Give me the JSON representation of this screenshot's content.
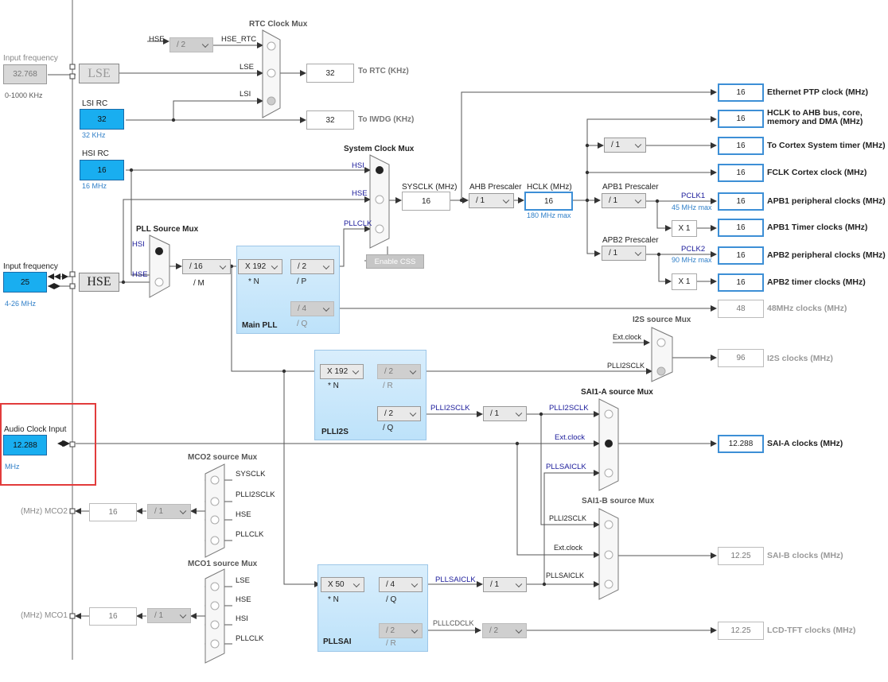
{
  "inputs": {
    "lse_input": {
      "title": "Input frequency",
      "value": "32.768",
      "range": "0-1000 KHz",
      "osc_label": "LSE"
    },
    "lsi_rc": {
      "title": "LSI RC",
      "value": "32",
      "unit": "32 KHz"
    },
    "hsi_rc": {
      "title": "HSI RC",
      "value": "16",
      "unit": "16 MHz"
    },
    "hse_input": {
      "title": "Input frequency",
      "value": "25",
      "range": "4-26 MHz",
      "osc_label": "HSE"
    },
    "audio_clock": {
      "title": "Audio Clock Input",
      "value": "12.288",
      "unit": "MHz"
    }
  },
  "rtc_mux": {
    "title": "RTC Clock Mux",
    "hse_label": "HSE",
    "hse_div": "/ 2",
    "inputs": [
      "HSE_RTC",
      "LSE",
      "LSI"
    ]
  },
  "to_rtc": {
    "value": "32",
    "label": "To RTC (KHz)"
  },
  "to_iwdg": {
    "value": "32",
    "label": "To IWDG (KHz)"
  },
  "system_mux": {
    "title": "System Clock Mux",
    "inputs": [
      "HSI",
      "HSE",
      "PLLCLK"
    ],
    "enable_css": "Enable CSS"
  },
  "sysclk": {
    "label": "SYSCLK (MHz)",
    "value": "16"
  },
  "ahb_prescaler": {
    "label": "AHB Prescaler",
    "value": "/ 1"
  },
  "hclk": {
    "label": "HCLK (MHz)",
    "value": "16",
    "max": "180 MHz max"
  },
  "apb1_prescaler": {
    "label": "APB1 Prescaler",
    "value": "/ 1",
    "pclk": "PCLK1",
    "max": "45 MHz max",
    "x": "X 1"
  },
  "apb2_prescaler": {
    "label": "APB2 Prescaler",
    "value": "/ 1",
    "pclk": "PCLK2",
    "max": "90 MHz max",
    "x": "X 1"
  },
  "cortex_div": "/ 1",
  "outputs": [
    {
      "value": "16",
      "label": "Ethernet PTP clock (MHz)"
    },
    {
      "value": "16",
      "label": "HCLK to AHB bus, core,",
      "label2": "memory and DMA (MHz)"
    },
    {
      "value": "16",
      "label": "To Cortex System timer (MHz)"
    },
    {
      "value": "16",
      "label": "FCLK Cortex clock (MHz)"
    },
    {
      "value": "16",
      "label": "APB1 peripheral clocks (MHz)"
    },
    {
      "value": "16",
      "label": "APB1 Timer clocks (MHz)"
    },
    {
      "value": "16",
      "label": "APB2 peripheral clocks (MHz)"
    },
    {
      "value": "16",
      "label": "APB2 timer clocks (MHz)"
    },
    {
      "value": "48",
      "label": "48MHz clocks (MHz)"
    },
    {
      "value": "96",
      "label": "I2S clocks (MHz)"
    },
    {
      "value": "12.288",
      "label": "SAI-A clocks (MHz)"
    },
    {
      "value": "12.25",
      "label": "SAI-B clocks (MHz)"
    },
    {
      "value": "12.25",
      "label": "LCD-TFT clocks (MHz)"
    }
  ],
  "pll_source_mux": {
    "title": "PLL Source Mux",
    "inputs": [
      "HSI",
      "HSE"
    ],
    "m_div": "/ 16",
    "m_label": "/ M"
  },
  "main_pll": {
    "title": "Main PLL",
    "n": "X 192",
    "n_label": "* N",
    "p": "/ 2",
    "p_label": "/ P",
    "q": "/ 4",
    "q_label": "/ Q"
  },
  "plli2s": {
    "title": "PLLI2S",
    "n": "X 192",
    "n_label": "* N",
    "r": "/ 2",
    "r_label": "/ R",
    "q": "/ 2",
    "q_label": "/ Q",
    "signal": "PLLI2SCLK",
    "div": "/ 1"
  },
  "pllsai": {
    "title": "PLLSAI",
    "n": "X 50",
    "n_label": "* N",
    "q": "/ 4",
    "q_label": "/ Q",
    "r": "/ 2",
    "r_label": "/ R",
    "signal": "PLLSAICLK",
    "div": "/ 1",
    "lcd_signal": "PLLLCDCLK",
    "lcd_div": "/ 2"
  },
  "i2s_mux": {
    "title": "I2S source Mux",
    "inputs": [
      "Ext.clock",
      "PLLI2SCLK"
    ]
  },
  "sai1a_mux": {
    "title": "SAI1-A source Mux",
    "inputs": [
      "PLLI2SCLK",
      "Ext.clock",
      "PLLSAICLK"
    ]
  },
  "sai1b_mux": {
    "title": "SAI1-B source Mux",
    "inputs": [
      "PLLI2SCLK",
      "Ext.clock",
      "PLLSAICLK"
    ]
  },
  "mco2": {
    "title": "MCO2 source Mux",
    "inputs": [
      "SYSCLK",
      "PLLI2SCLK",
      "HSE",
      "PLLCLK"
    ],
    "div": "/ 1",
    "value": "16",
    "pin": "(MHz) MCO2"
  },
  "mco1": {
    "title": "MCO1 source Mux",
    "inputs": [
      "LSE",
      "HSE",
      "HSI",
      "PLLCLK"
    ],
    "div": "/ 1",
    "value": "16",
    "pin": "(MHz) MCO1"
  }
}
